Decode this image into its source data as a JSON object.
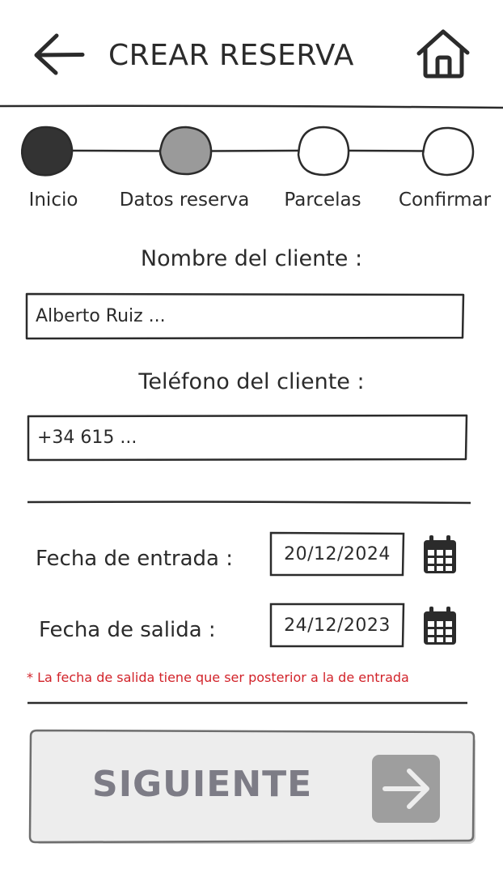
{
  "header": {
    "title": "CREAR RESERVA",
    "back_icon": "arrow-left-icon",
    "home_icon": "home-icon"
  },
  "stepper": {
    "steps": [
      {
        "label": "Inicio",
        "state": "completed",
        "color": "#333333"
      },
      {
        "label": "Datos reserva",
        "state": "current",
        "color": "#9a9a9a"
      },
      {
        "label": "Parcelas",
        "state": "pending",
        "color": "#ffffff"
      },
      {
        "label": "Confirmar",
        "state": "pending",
        "color": "#ffffff"
      }
    ]
  },
  "form": {
    "client_name": {
      "label": "Nombre del cliente :",
      "value": "Alberto Ruiz ..."
    },
    "client_phone": {
      "label": "Teléfono del cliente :",
      "value": "+34 615 ..."
    },
    "check_in": {
      "label": "Fecha de entrada :",
      "value": "20/12/2024",
      "icon": "calendar-icon"
    },
    "check_out": {
      "label": "Fecha de salida :",
      "value": "24/12/2023",
      "icon": "calendar-icon"
    },
    "error": "* La fecha de salida tiene que ser posterior a la de entrada",
    "error_color": "#d2232a"
  },
  "next_button": {
    "label": "SIGUIENTE",
    "state": "disabled",
    "icon": "arrow-right-icon"
  }
}
